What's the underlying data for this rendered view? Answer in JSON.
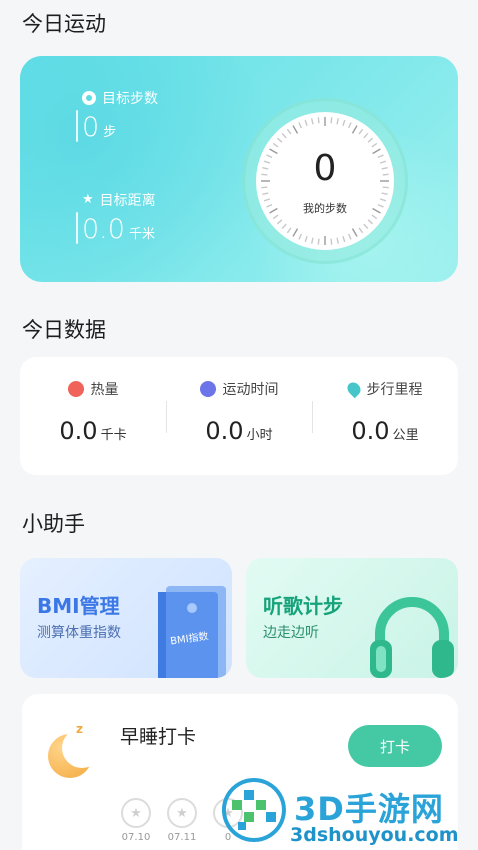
{
  "today_sport": {
    "title": "今日运动",
    "goal_steps": {
      "label": "目标步数",
      "value": "0",
      "unit": "步"
    },
    "goal_distance": {
      "label": "目标距离",
      "value": "0.0",
      "unit": "千米"
    },
    "dial": {
      "value": "0",
      "label": "我的步数"
    }
  },
  "today_data": {
    "title": "今日数据",
    "stats": [
      {
        "label": "热量",
        "value": "0.0",
        "unit": "千卡",
        "color": "#f0635a"
      },
      {
        "label": "运动时间",
        "value": "0.0",
        "unit": "小时",
        "color": "#6b74e8"
      },
      {
        "label": "步行里程",
        "value": "0.0",
        "unit": "公里",
        "color": "#46c6c9"
      }
    ]
  },
  "assistant": {
    "title": "小助手",
    "bmi": {
      "title": "BMI管理",
      "subtitle": "测算体重指数",
      "book_label": "BMI指数"
    },
    "music": {
      "title": "听歌计步",
      "subtitle": "边走边听"
    }
  },
  "sleep": {
    "title": "早睡打卡",
    "button": "打卡",
    "badge": "z",
    "days": [
      {
        "date": "07.10",
        "icon": "star-icon"
      },
      {
        "date": "07.11",
        "icon": "star-icon"
      },
      {
        "date": "0",
        "icon": "star-icon"
      }
    ]
  },
  "watermark": {
    "brand": "3D手游网",
    "url": "3dshouyou.com"
  },
  "colors": {
    "accent": "#45c9a5",
    "hero": "#63e0e6",
    "bmi_text": "#3b78e6",
    "music_text": "#16a37a"
  }
}
